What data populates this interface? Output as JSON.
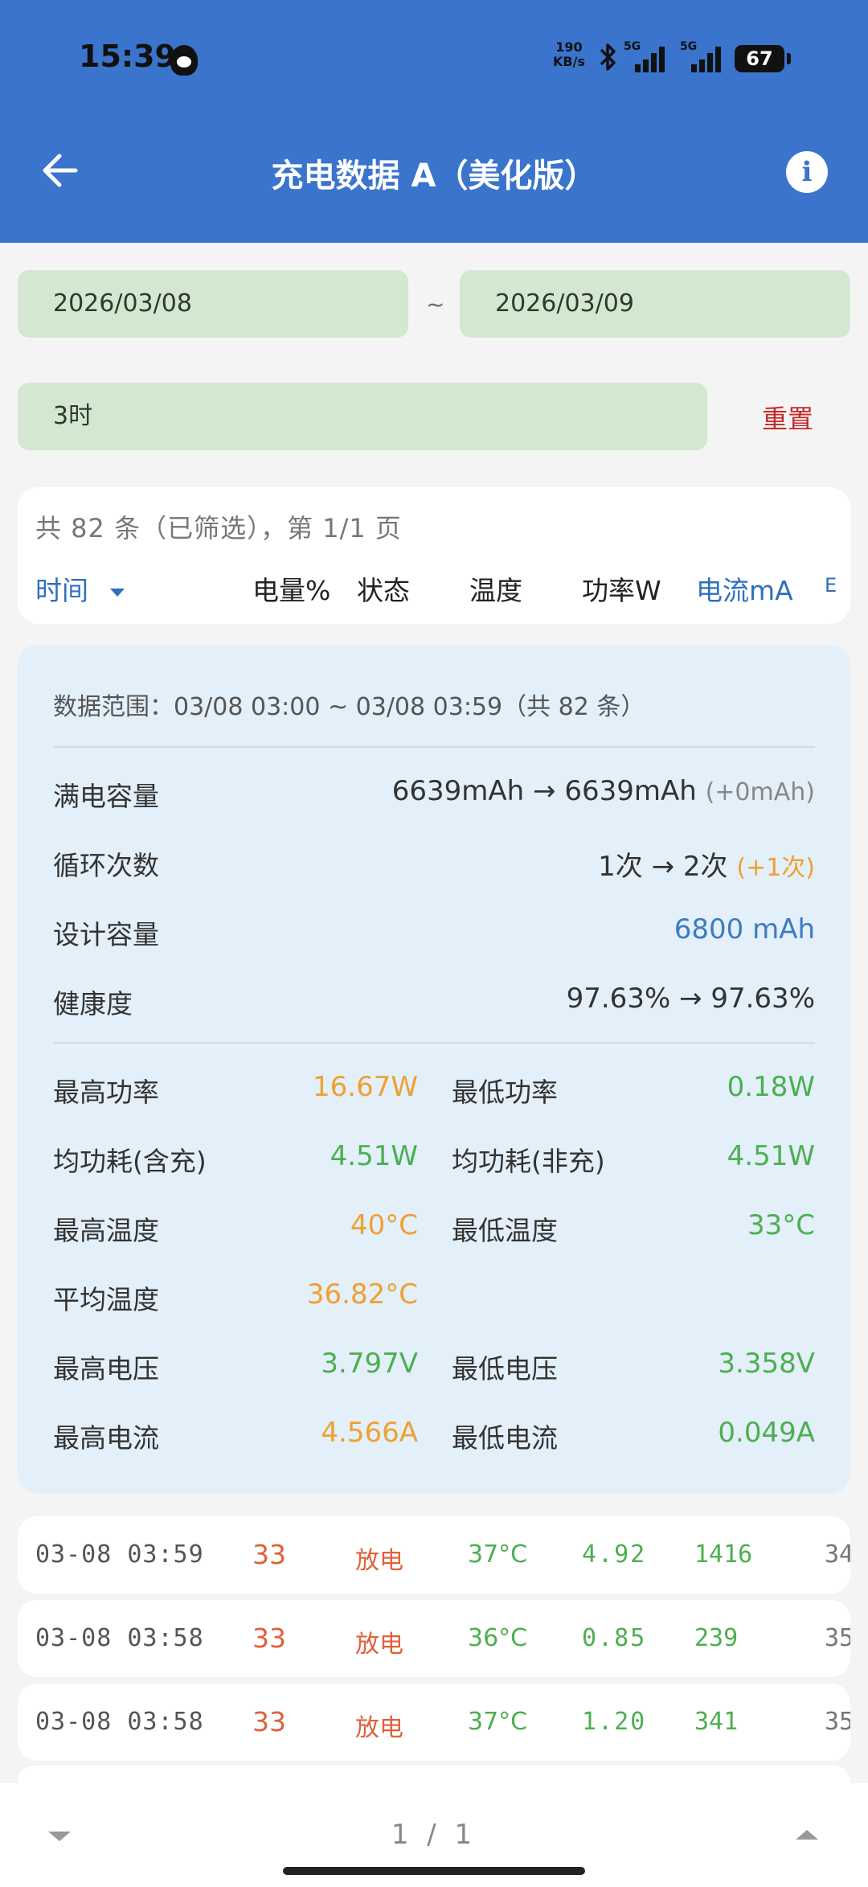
{
  "status_bar": {
    "time": "15:39",
    "net_speed_value": "190",
    "net_speed_unit": "KB/s",
    "signal_1": "5G",
    "signal_2": "5G",
    "battery": "67"
  },
  "header": {
    "title": "充电数据 A（美化版）",
    "bg_color": "#3a74cc"
  },
  "filters": {
    "start_date": "2026/03/08",
    "separator": "~",
    "end_date": "2026/03/09",
    "hour": "3时",
    "reset_label": "重置"
  },
  "list_header": {
    "summary": "共 82 条（已筛选），第 1/1 页",
    "columns": {
      "time": "时间",
      "level": "电量%",
      "status": "状态",
      "temp": "温度",
      "power": "功率W",
      "current": "电流mA",
      "voltage_partial": "E"
    }
  },
  "stats": {
    "range": "数据范围：03/08 03:00 ~ 03/08 03:59（共 82 条）",
    "full_capacity": {
      "label": "满电容量",
      "value": "6639mAh → 6639mAh",
      "delta": "(+0mAh)"
    },
    "cycles": {
      "label": "循环次数",
      "value": "1次 → 2次",
      "delta": "(+1次)"
    },
    "design_capacity": {
      "label": "设计容量",
      "value": "6800 mAh"
    },
    "health": {
      "label": "健康度",
      "value": "97.63% → 97.63%"
    },
    "max_power": {
      "label": "最高功率",
      "value": "16.67W"
    },
    "min_power": {
      "label": "最低功率",
      "value": "0.18W"
    },
    "avg_consumption_incl": {
      "label": "均功耗(含充)",
      "value": "4.51W"
    },
    "avg_consumption_excl": {
      "label": "均功耗(非充)",
      "value": "4.51W"
    },
    "max_temp": {
      "label": "最高温度",
      "value": "40°C"
    },
    "min_temp": {
      "label": "最低温度",
      "value": "33°C"
    },
    "avg_temp": {
      "label": "平均温度",
      "value": "36.82°C"
    },
    "max_voltage": {
      "label": "最高电压",
      "value": "3.797V"
    },
    "min_voltage": {
      "label": "最低电压",
      "value": "3.358V"
    },
    "max_current": {
      "label": "最高电流",
      "value": "4.566A"
    },
    "min_current": {
      "label": "最低电流",
      "value": "0.049A"
    }
  },
  "rows": [
    {
      "time": "03-08 03:59",
      "level": "33",
      "status": "放电",
      "temp": "37°C",
      "power": "4.92",
      "current": "1416",
      "voltage": "34"
    },
    {
      "time": "03-08 03:58",
      "level": "33",
      "status": "放电",
      "temp": "36°C",
      "power": "0.85",
      "current": "239",
      "voltage": "35"
    },
    {
      "time": "03-08 03:58",
      "level": "33",
      "status": "放电",
      "temp": "37°C",
      "power": "1.20",
      "current": "341",
      "voltage": "35"
    }
  ],
  "pager": {
    "text": "1 / 1"
  }
}
